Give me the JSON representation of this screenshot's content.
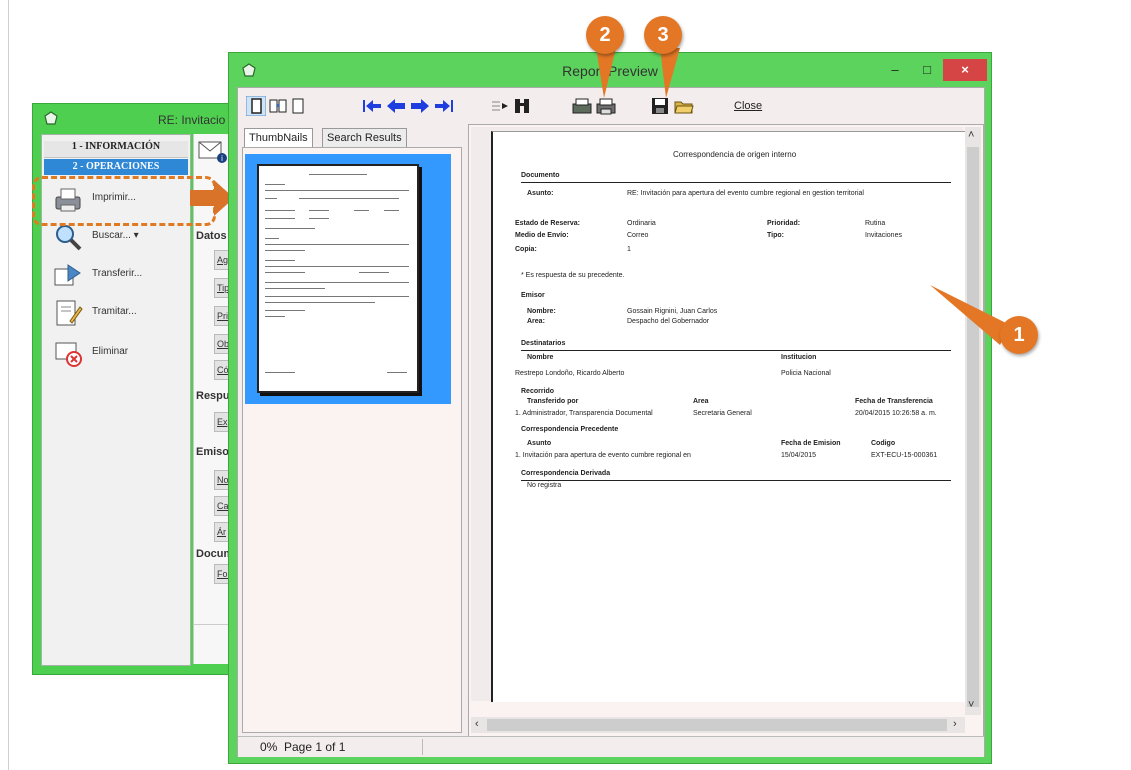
{
  "back_window": {
    "title": "RE: Invitacio",
    "nav_sections": [
      "1 - INFORMACIÓN",
      "2 - OPERACIONES"
    ],
    "actions": [
      {
        "label": "Imprimir...",
        "icon": "printer-icon"
      },
      {
        "label": "Buscar... ▾",
        "icon": "magnifier-icon"
      },
      {
        "label": "Transferir...",
        "icon": "transfer-icon"
      },
      {
        "label": "Tramitar...",
        "icon": "edit-document-icon"
      },
      {
        "label": "Eliminar",
        "icon": "delete-icon"
      }
    ],
    "mid_headers": [
      "Datos",
      "Respu",
      "Emiso",
      "Docum"
    ],
    "mid_fields": [
      "Ag",
      "Tip",
      "Pri",
      "Ob",
      "Có",
      "Ex",
      "No",
      "Ca",
      "Ár",
      "For"
    ]
  },
  "window": {
    "title": "Report Preview",
    "controls": {
      "minimize": "–",
      "maximize": "□",
      "close": "×"
    }
  },
  "toolbar": {
    "close_label": "Close"
  },
  "tabs": {
    "thumbnails": "ThumbNails",
    "search_results": "Search Results"
  },
  "status": {
    "percent": "0%",
    "page": "Page 1 of 1"
  },
  "callouts": {
    "one": "1",
    "two": "2",
    "three": "3"
  },
  "document": {
    "title": "Correspondencia de origen interno",
    "sections": {
      "documento": "Documento",
      "emisor": "Emisor",
      "destinatarios": "Destinatarios",
      "recorrido": "Recorrido",
      "precedente": "Correspondencia Precedente",
      "derivada": "Correspondencia Derivada"
    },
    "asunto_label": "Asunto:",
    "asunto_value": "RE: Invitación para apertura del evento cumbre regional en gestion territorial",
    "fields": {
      "estado_label": "Estado de Reserva:",
      "estado_value": "Ordinaria",
      "prioridad_label": "Prioridad:",
      "prioridad_value": "Rutina",
      "medio_label": "Medio de Envío:",
      "medio_value": "Correo",
      "tipo_label": "Tipo:",
      "tipo_value": "Invitaciones",
      "copia_label": "Copia:",
      "copia_value": "1"
    },
    "note": "* Es respuesta de su precedente.",
    "emisor": {
      "nombre_label": "Nombre:",
      "nombre_value": "Gossain Rignini, Juan Carlos",
      "area_label": "Area:",
      "area_value": "Despacho del Gobernador"
    },
    "destinatarios": {
      "col_nombre": "Nombre",
      "col_institucion": "Institucion",
      "row_nombre": "Restrepo Londoño, Ricardo Alberto",
      "row_institucion": "Policia Nacional"
    },
    "recorrido": {
      "col_transferido": "Transferido por",
      "col_area": "Area",
      "col_fecha": "Fecha de Transferencia",
      "row_transferido": "1. Administrador, Transparencia Documental",
      "row_area": "Secretaria General",
      "row_fecha": "20/04/2015 10:26:58 a. m."
    },
    "precedente": {
      "col_asunto": "Asunto",
      "col_fecha": "Fecha de Emision",
      "col_codigo": "Codigo",
      "row_asunto": "1. Invitación para apertura de evento cumbre regional en",
      "row_fecha": "15/04/2015",
      "row_codigo": "EXT-ECU-15-000361"
    },
    "derivada_value": "No registra"
  },
  "colors": {
    "window_border": "#5cd35c",
    "callout": "#e37725",
    "selection": "#3399ff",
    "close_button": "#d64545"
  }
}
